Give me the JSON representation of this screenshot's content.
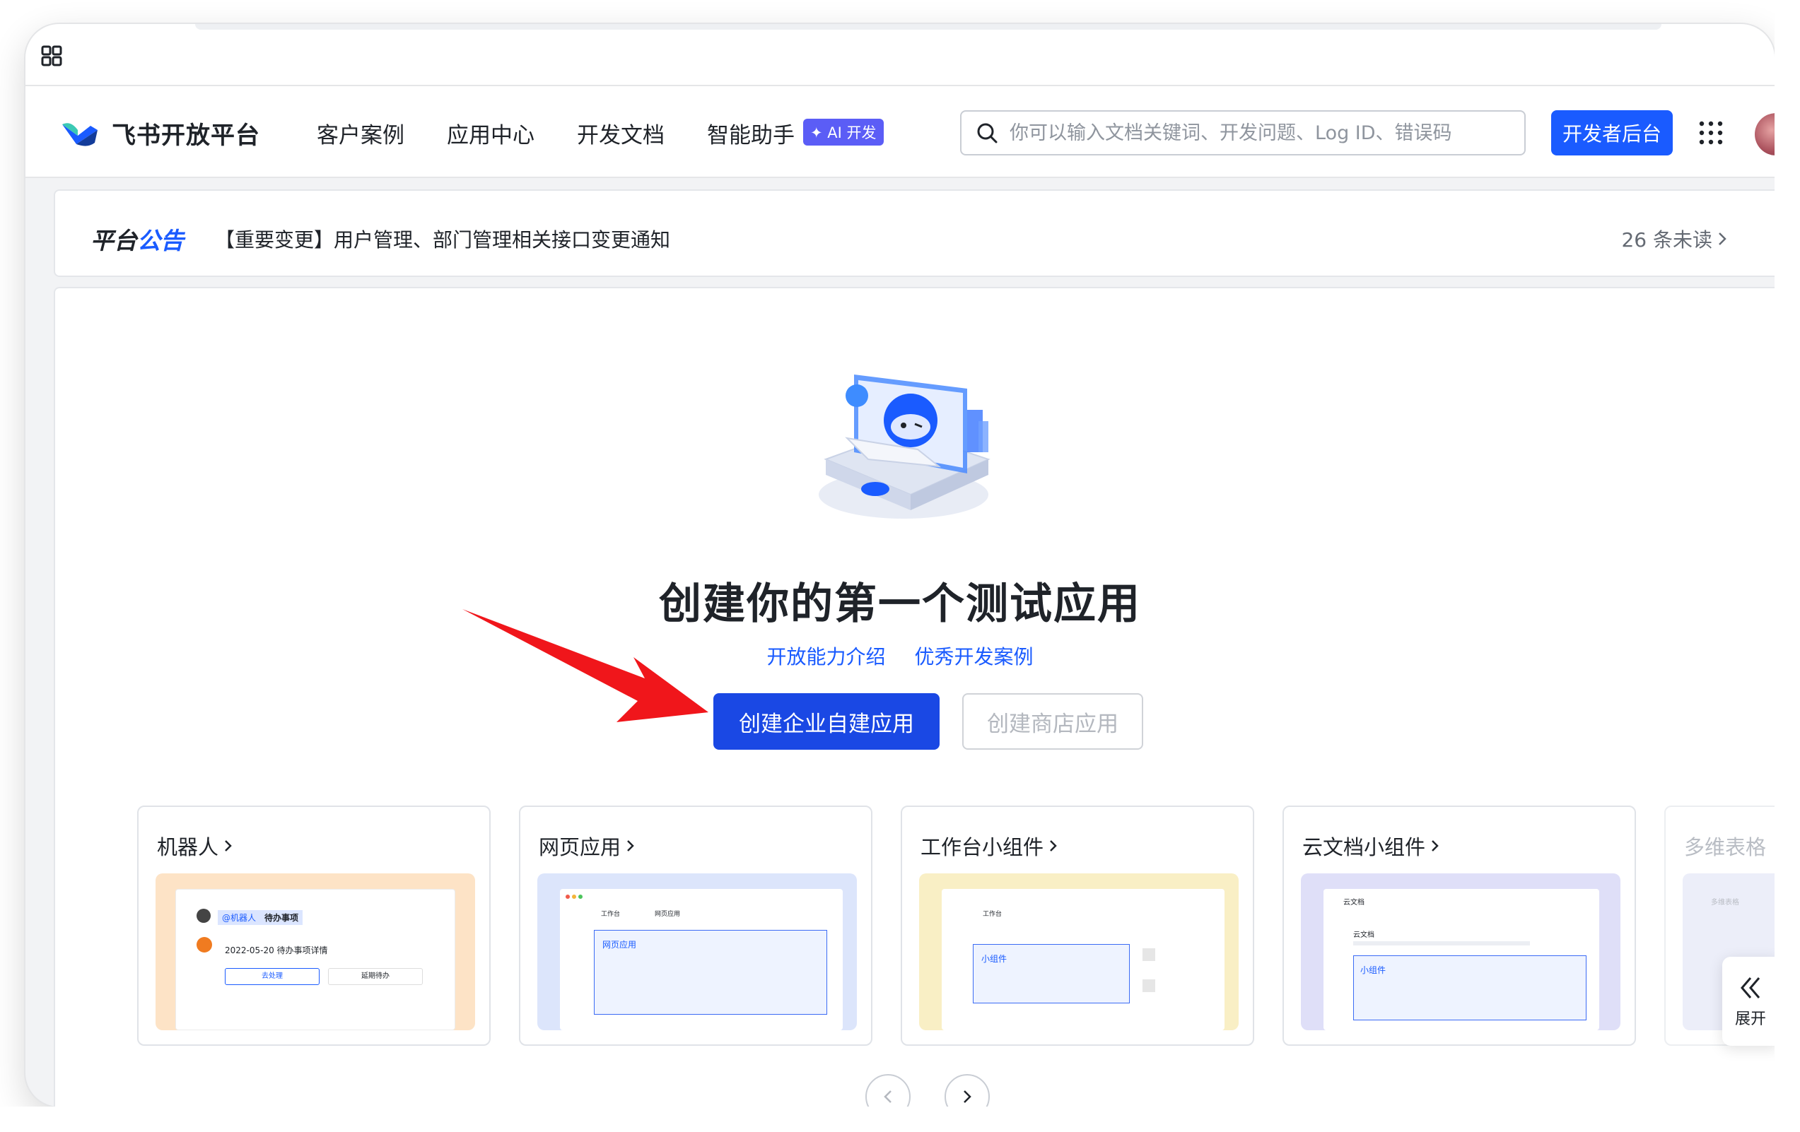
{
  "brand": {
    "name": "飞书开放平台"
  },
  "nav": {
    "items": [
      "客户案例",
      "应用中心",
      "开发文档",
      "智能助手"
    ],
    "ai_badge": "✦ AI 开发"
  },
  "search": {
    "placeholder": "你可以输入文档关键词、开发问题、Log ID、错误码"
  },
  "dev_console": "开发者后台",
  "notice": {
    "title_a": "平台",
    "title_b": "公告",
    "text": "【重要变更】用户管理、部门管理相关接口变更通知",
    "unread": "26 条未读"
  },
  "hero": {
    "title": "创建你的第一个测试应用",
    "links": [
      "开放能力介绍",
      "优秀开发案例"
    ],
    "primary_button": "创建企业自建应用",
    "secondary_button": "创建商店应用"
  },
  "app_types": [
    {
      "title": "机器人",
      "preview": {
        "bg": "#fde3c6",
        "tag": "@机器人",
        "tag2": "待办事项",
        "line": "2022-05-20 待办事项详情",
        "btn1": "去处理",
        "btn2": "延期待办"
      }
    },
    {
      "title": "网页应用",
      "preview": {
        "bg": "#dce5fb",
        "tab1": "工作台",
        "tab2": "网页应用",
        "content": "网页应用"
      }
    },
    {
      "title": "工作台小组件",
      "preview": {
        "bg": "#f9efc5",
        "tab1": "工作台",
        "content": "小组件"
      }
    },
    {
      "title": "云文档小组件",
      "preview": {
        "bg": "#dfdff8",
        "header": "云文档",
        "doc": "云文档",
        "content": "小组件"
      }
    },
    {
      "title": "多维表格",
      "preview": {
        "bg": "#e4e6f8",
        "header": "多维表格"
      }
    }
  ],
  "expand": "展开",
  "colors": {
    "brand_blue": "#1a5bff",
    "primary_btn": "#1a48e4",
    "ai_badge": "#5b5df6",
    "annotation_arrow": "#f0161b"
  }
}
